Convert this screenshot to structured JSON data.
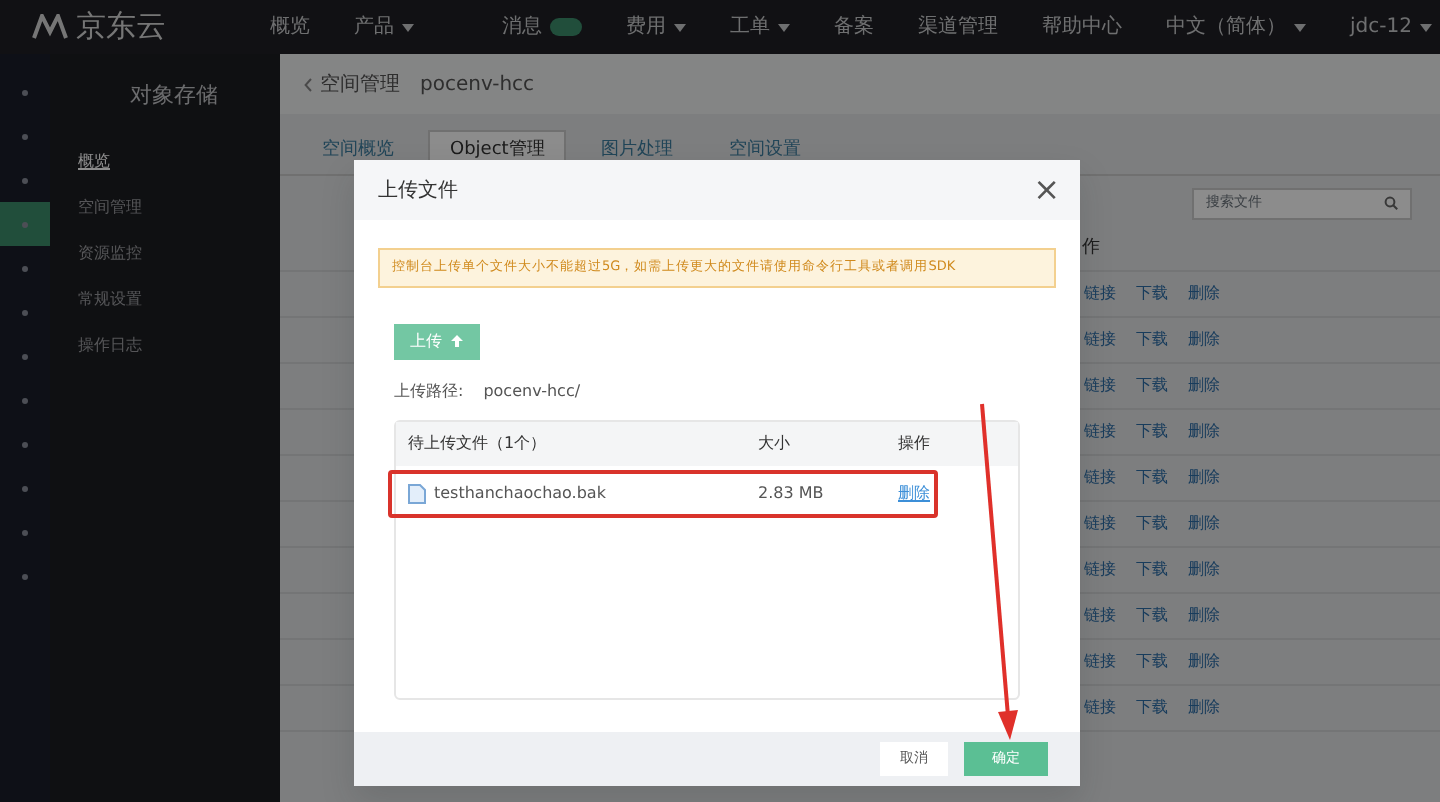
{
  "topbar": {
    "logo": "京东云",
    "left_items": [
      {
        "label": "概览",
        "dropdown": false
      },
      {
        "label": "产品",
        "dropdown": true
      }
    ],
    "right_items": [
      {
        "label": "消息",
        "dropdown": false,
        "badge": true
      },
      {
        "label": "费用",
        "dropdown": true,
        "badge": false
      },
      {
        "label": "工单",
        "dropdown": true,
        "badge": false
      },
      {
        "label": "备案",
        "dropdown": false,
        "badge": false
      },
      {
        "label": "渠道管理",
        "dropdown": false,
        "badge": false
      },
      {
        "label": "帮助中心",
        "dropdown": false,
        "badge": false
      },
      {
        "label": "中文（简体）",
        "dropdown": true,
        "badge": false
      },
      {
        "label": "jdc-12",
        "dropdown": true,
        "badge": false
      }
    ]
  },
  "rail": {
    "items": [
      {
        "selected": false
      },
      {
        "selected": false
      },
      {
        "selected": false
      },
      {
        "selected": true
      },
      {
        "selected": false
      },
      {
        "selected": false
      },
      {
        "selected": false
      },
      {
        "selected": false
      },
      {
        "selected": false
      },
      {
        "selected": false
      },
      {
        "selected": false
      },
      {
        "selected": false
      }
    ]
  },
  "sidebar": {
    "title": "对象存储",
    "items": [
      {
        "label": "概览",
        "selected": true
      },
      {
        "label": "空间管理",
        "selected": false
      },
      {
        "label": "资源监控",
        "selected": false
      },
      {
        "label": "常规设置",
        "selected": false
      },
      {
        "label": "操作日志",
        "selected": false
      }
    ]
  },
  "breadcrumb": {
    "back": "空间管理",
    "current": "pocenv-hcc"
  },
  "tabs": [
    {
      "label": "空间概览",
      "selected": false
    },
    {
      "label": "Object管理",
      "selected": true
    },
    {
      "label": "图片处理",
      "selected": false
    },
    {
      "label": "空间设置",
      "selected": false
    }
  ],
  "search": {
    "placeholder": "搜索文件"
  },
  "table": {
    "header": "作",
    "rows": [
      {
        "actions": [
          "链接",
          "下载",
          "删除"
        ]
      },
      {
        "actions": [
          "链接",
          "下载",
          "删除"
        ]
      },
      {
        "actions": [
          "链接",
          "下载",
          "删除"
        ]
      },
      {
        "actions": [
          "链接",
          "下载",
          "删除"
        ]
      },
      {
        "actions": [
          "链接",
          "下载",
          "删除"
        ]
      },
      {
        "actions": [
          "链接",
          "下载",
          "删除"
        ]
      },
      {
        "actions": [
          "链接",
          "下载",
          "删除"
        ]
      },
      {
        "actions": [
          "链接",
          "下载",
          "删除"
        ]
      },
      {
        "actions": [
          "链接",
          "下载",
          "删除"
        ]
      },
      {
        "actions": [
          "链接",
          "下载",
          "删除"
        ]
      }
    ]
  },
  "modal": {
    "title": "上传文件",
    "close": "×",
    "notice": "控制台上传单个文件大小不能超过5G，如需上传更大的文件请使用命令行工具或者调用",
    "notice_link": "SDK",
    "upload_button": "上传",
    "path_label": "上传路径:",
    "path": "pocenv-hcc/",
    "columns": [
      "待上传文件（1个）",
      "大小",
      "操作"
    ],
    "files": [
      {
        "name": "testhanchaochao.bak",
        "size": "2.83 MB",
        "action": "删除",
        "highlighted": true
      }
    ],
    "buttons": [
      {
        "label": "取消",
        "kind": "secondary"
      },
      {
        "label": "确定",
        "kind": "primary"
      }
    ]
  },
  "annotation": {
    "arrow": true
  }
}
